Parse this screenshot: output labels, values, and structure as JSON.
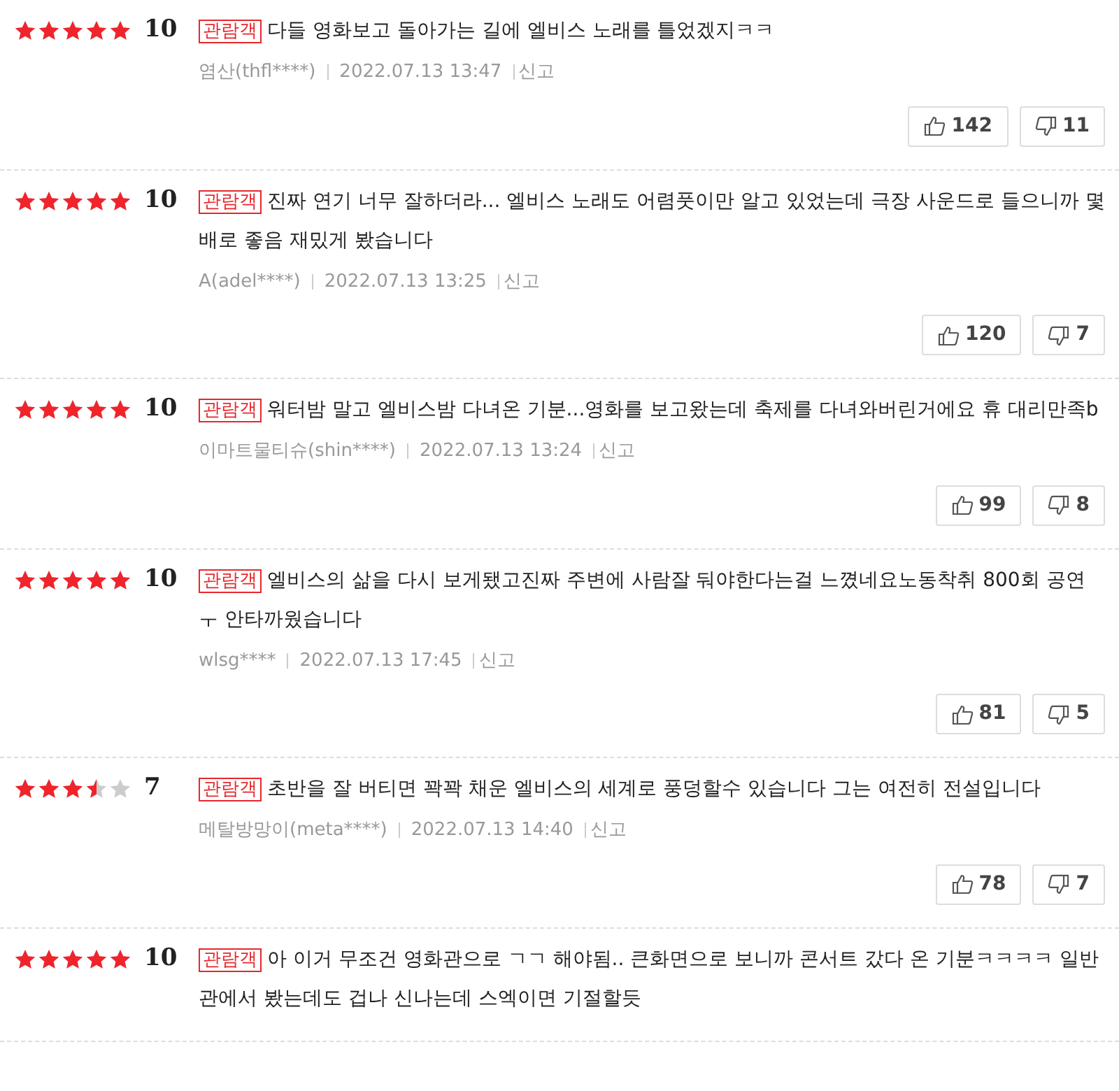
{
  "reviews": [
    {
      "stars": 5,
      "score": "10",
      "badge": "관람객",
      "text": "다들 영화보고 돌아가는 길에 엘비스 노래를 틀었겠지ㅋㅋ",
      "author": "염산(thfl****)",
      "date": "2022.07.13 13:47",
      "report": "신고",
      "likes": "142",
      "dislikes": "11"
    },
    {
      "stars": 5,
      "score": "10",
      "badge": "관람객",
      "text": "진짜 연기 너무 잘하더라... 엘비스 노래도 어렴풋이만 알고 있었는데 극장 사운드로 들으니까 몇배로 좋음 재밌게 봤습니다",
      "author": "A(adel****)",
      "date": "2022.07.13 13:25",
      "report": "신고",
      "likes": "120",
      "dislikes": "7"
    },
    {
      "stars": 5,
      "score": "10",
      "badge": "관람객",
      "text": "워터밤 말고 엘비스밤 다녀온 기분...영화를 보고왔는데 축제를 다녀와버린거에요 휴 대리만족b",
      "author": "이마트물티슈(shin****)",
      "date": "2022.07.13 13:24",
      "report": "신고",
      "likes": "99",
      "dislikes": "8"
    },
    {
      "stars": 5,
      "score": "10",
      "badge": "관람객",
      "text": "엘비스의 삶을 다시 보게됐고진짜 주변에 사람잘 둬야한다는걸 느꼈네요노동착취 800회 공연 ㅜ 안타까웠습니다",
      "author": "wlsg****",
      "date": "2022.07.13 17:45",
      "report": "신고",
      "likes": "81",
      "dislikes": "5"
    },
    {
      "stars": 3.5,
      "score": "7",
      "badge": "관람객",
      "text": "초반을 잘 버티면 꽉꽉 채운 엘비스의 세계로 풍덩할수 있습니다 그는 여전히 전설입니다",
      "author": "메탈방망이(meta****)",
      "date": "2022.07.13 14:40",
      "report": "신고",
      "likes": "78",
      "dislikes": "7"
    },
    {
      "stars": 5,
      "score": "10",
      "badge": "관람객",
      "text": "아 이거 무조건 영화관으로 ㄱㄱ 해야됨.. 큰화면으로 보니까 콘서트 갔다 온 기분ㅋㅋㅋㅋ 일반관에서 봤는데도 겁나 신나는데 스엑이면 기절할듯"
    }
  ]
}
